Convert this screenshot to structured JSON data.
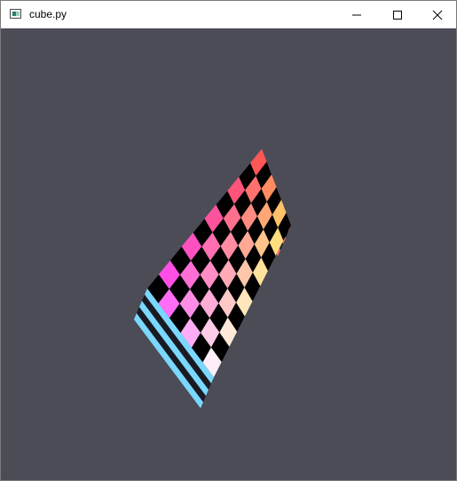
{
  "window": {
    "title": "cube.py",
    "buttons": {
      "minimize_icon": "minimize-icon",
      "maximize_icon": "maximize-icon",
      "close_icon": "close-icon"
    }
  },
  "viewport": {
    "background": "#4b4c56",
    "checker_board": {
      "rows": 10,
      "cols": 6,
      "dark_color": "#000000",
      "corner_colors": {
        "top": "#ff4a4a",
        "right": "#ffe86a",
        "bottom": "#ffffff",
        "left": "#ff3cff"
      },
      "edge_colors": [
        "#8a7cff",
        "#d67cff",
        "#7ad8ff"
      ]
    }
  }
}
